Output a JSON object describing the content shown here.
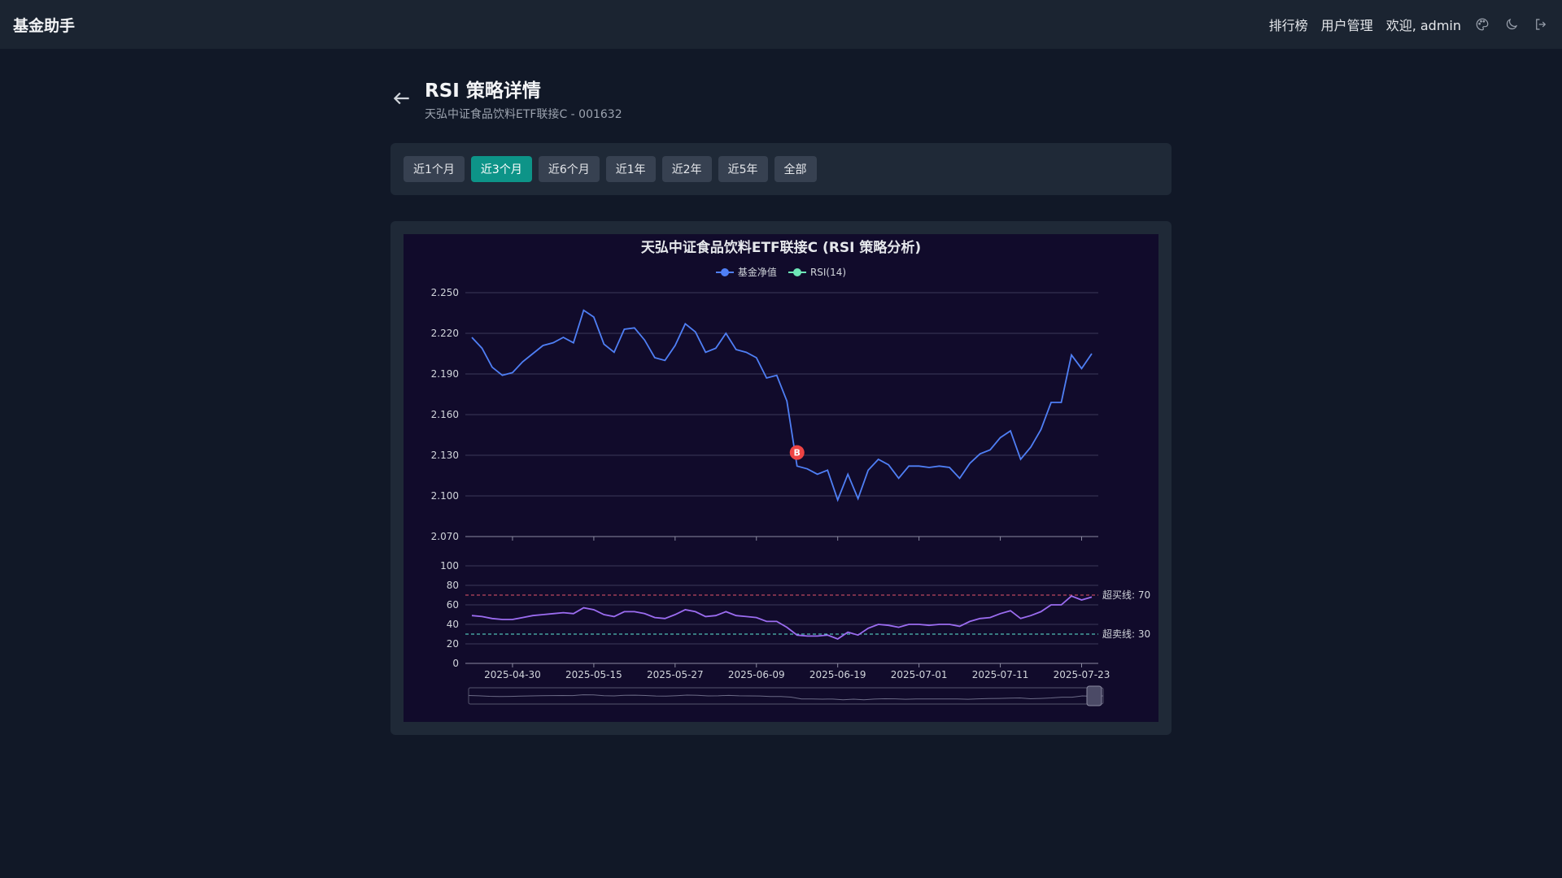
{
  "app": {
    "brand": "基金助手"
  },
  "nav": {
    "ranking": "排行榜",
    "user_mgmt": "用户管理",
    "welcome": "欢迎, admin",
    "icons": [
      "palette-icon",
      "moon-icon",
      "logout-icon"
    ]
  },
  "page": {
    "title": "RSI 策略详情",
    "subtitle": "天弘中证食品饮料ETF联接C - 001632"
  },
  "ranges": [
    {
      "label": "近1个月",
      "active": false
    },
    {
      "label": "近3个月",
      "active": true
    },
    {
      "label": "近6个月",
      "active": false
    },
    {
      "label": "近1年",
      "active": false
    },
    {
      "label": "近2年",
      "active": false
    },
    {
      "label": "近5年",
      "active": false
    },
    {
      "label": "全部",
      "active": false
    }
  ],
  "colors": {
    "accent": "#0d9488",
    "nav_line": "#4f7ff5",
    "rsi_line": "#9b6cf0",
    "overbought": "#e2556b",
    "oversold": "#5eead4",
    "buy_marker": "#ef4444"
  },
  "chart_data": {
    "type": "line",
    "title": "天弘中证食品饮料ETF联接C (RSI 策略分析)",
    "legend": [
      "基金净值",
      "RSI(14)"
    ],
    "nav_axis": {
      "ylim": [
        2.07,
        2.25
      ],
      "ticks": [
        "2.250",
        "2.220",
        "2.190",
        "2.160",
        "2.130",
        "2.100",
        "2.070"
      ]
    },
    "rsi_axis": {
      "ylim": [
        0,
        100
      ],
      "ticks": [
        "100",
        "80",
        "60",
        "40",
        "20",
        "0"
      ]
    },
    "x_tick_labels": [
      "2025-04-30",
      "2025-05-15",
      "2025-05-27",
      "2025-06-09",
      "2025-06-19",
      "2025-07-01",
      "2025-07-11",
      "2025-07-23"
    ],
    "x_tick_index": [
      4,
      12,
      20,
      28,
      36,
      44,
      52,
      60
    ],
    "series": [
      {
        "name": "基金净值",
        "values": [
          2.217,
          2.209,
          2.195,
          2.189,
          2.191,
          2.199,
          2.205,
          2.211,
          2.213,
          2.217,
          2.213,
          2.237,
          2.232,
          2.212,
          2.206,
          2.223,
          2.224,
          2.215,
          2.202,
          2.2,
          2.211,
          2.227,
          2.221,
          2.206,
          2.209,
          2.22,
          2.208,
          2.206,
          2.202,
          2.187,
          2.189,
          2.17,
          2.122,
          2.12,
          2.116,
          2.119,
          2.097,
          2.116,
          2.098,
          2.119,
          2.127,
          2.123,
          2.113,
          2.122,
          2.122,
          2.121,
          2.122,
          2.121,
          2.113,
          2.124,
          2.131,
          2.134,
          2.143,
          2.148,
          2.127,
          2.136,
          2.149,
          2.169,
          2.169,
          2.204,
          2.194,
          2.205
        ]
      },
      {
        "name": "RSI(14)",
        "values": [
          49,
          48,
          46,
          45,
          45,
          47,
          49,
          50,
          51,
          52,
          51,
          57,
          55,
          50,
          48,
          53,
          53,
          51,
          47,
          46,
          50,
          55,
          53,
          48,
          49,
          53,
          49,
          48,
          47,
          43,
          43,
          37,
          29,
          28,
          28,
          29,
          25,
          32,
          29,
          36,
          40,
          39,
          37,
          40,
          40,
          39,
          40,
          40,
          38,
          43,
          46,
          47,
          51,
          54,
          46,
          49,
          53,
          60,
          60,
          69,
          65,
          68
        ]
      }
    ],
    "thresholds": [
      {
        "label": "超买线: 70",
        "value": 70
      },
      {
        "label": "超卖线: 30",
        "value": 30
      }
    ],
    "markers": [
      {
        "label": "B",
        "index": 32,
        "value": 2.132
      }
    ],
    "grid": true
  }
}
